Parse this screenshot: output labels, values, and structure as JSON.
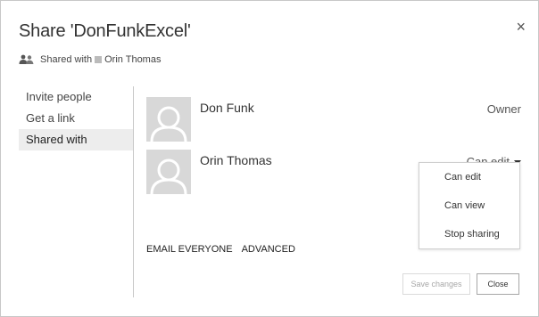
{
  "dialog": {
    "title": "Share 'DonFunkExcel'",
    "close_glyph": "×"
  },
  "subline": {
    "prefix": "Shared with",
    "name": "Orin Thomas",
    "icon": "people-icon"
  },
  "nav": {
    "items": [
      {
        "label": "Invite people"
      },
      {
        "label": "Get a link"
      },
      {
        "label": "Shared with"
      }
    ],
    "selected": "Shared with"
  },
  "people": [
    {
      "name": "Don Funk",
      "role": "Owner"
    },
    {
      "name": "Orin Thomas",
      "role": "Can edit"
    }
  ],
  "role_menu": {
    "options": [
      "Can edit",
      "Can view",
      "Stop sharing"
    ]
  },
  "links": {
    "email_everyone": "EMAIL EVERYONE",
    "advanced": "ADVANCED"
  },
  "buttons": {
    "save": "Save changes",
    "close": "Close"
  },
  "colors": {
    "selected_nav_bg": "#ededed",
    "avatar_bg": "#d8d8d8",
    "disabled_text": "#a8a8a8"
  }
}
